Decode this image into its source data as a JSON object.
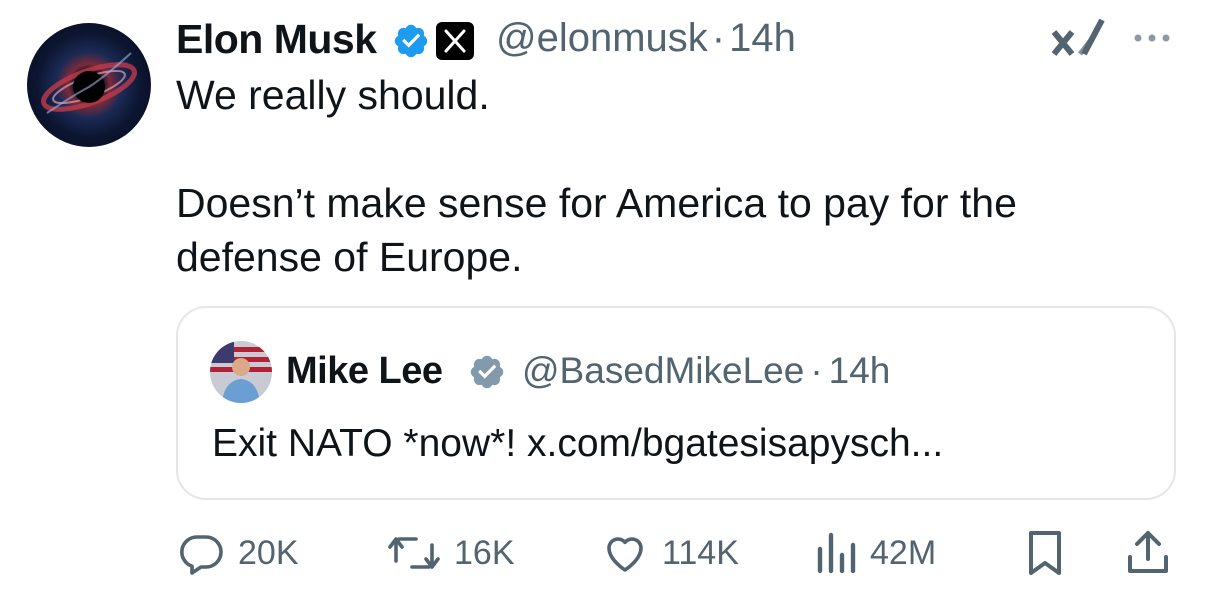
{
  "author": {
    "name": "Elon Musk",
    "handle": "@elonmusk",
    "separator": "·",
    "time": "14h",
    "verified": true,
    "affiliation_badge": "x-logo-icon"
  },
  "tweet": {
    "line1": "We really should.",
    "line2": "Doesn’t make sense for America to pay for the",
    "line3": "defense of Europe."
  },
  "quoted": {
    "name": "Mike Lee",
    "handle": "@BasedMikeLee",
    "separator": "·",
    "time": "14h",
    "text": "Exit NATO *now*! x.com/bgatesisapysch..."
  },
  "actions": {
    "replies": "20K",
    "reposts": "16K",
    "likes": "114K",
    "views": "42M"
  },
  "colors": {
    "text": "#0f1419",
    "muted": "#536471",
    "verified": "#1d9bf0",
    "quoted_verified": "#829aab",
    "border": "#e3e7ea"
  },
  "icons": [
    "more-icon",
    "xai-logo",
    "reply-icon",
    "repost-icon",
    "like-icon",
    "views-icon",
    "bookmark-icon",
    "share-icon"
  ]
}
